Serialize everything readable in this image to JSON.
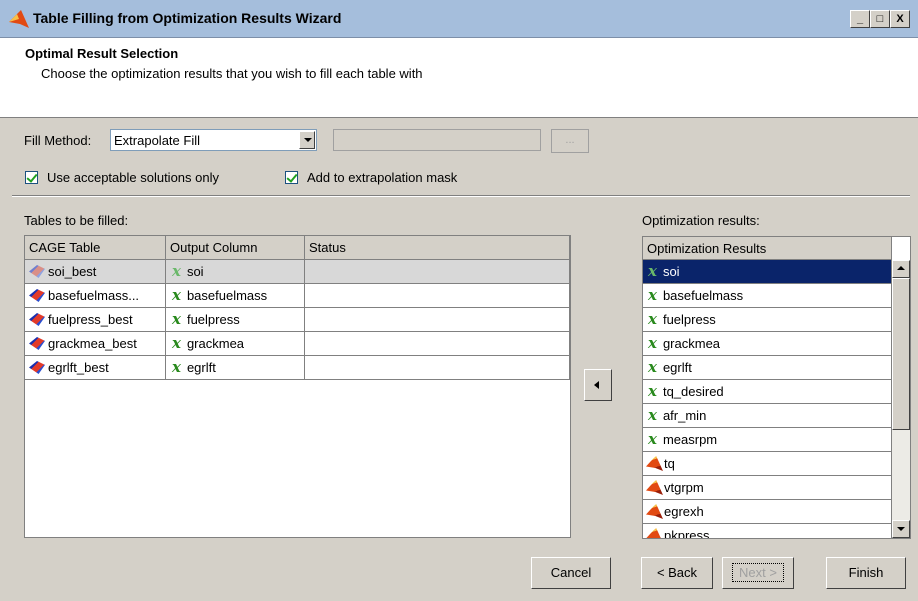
{
  "window": {
    "title": "Table Filling from Optimization Results Wizard",
    "minimize": "_",
    "maximize": "□",
    "close": "X"
  },
  "header": {
    "title": "Optimal Result Selection",
    "subtitle": "Choose the optimization results that you wish to fill each table with"
  },
  "fill_method": {
    "label": "Fill Method:",
    "value": "Extrapolate Fill",
    "browse_label": "..."
  },
  "checkboxes": {
    "acceptable": {
      "label": "Use acceptable solutions only",
      "checked": true
    },
    "mask": {
      "label": "Add to extrapolation mask",
      "checked": true
    }
  },
  "tables": {
    "label": "Tables to be filled:",
    "columns": [
      "CAGE Table",
      "Output Column",
      "Status"
    ],
    "rows": [
      {
        "table": "soi_best",
        "output": "soi",
        "status": ""
      },
      {
        "table": "basefuelmass...",
        "output": "basefuelmass",
        "status": ""
      },
      {
        "table": "fuelpress_best",
        "output": "fuelpress",
        "status": ""
      },
      {
        "table": "grackmea_best",
        "output": "grackmea",
        "status": ""
      },
      {
        "table": "egrlft_best",
        "output": "egrlft",
        "status": ""
      }
    ]
  },
  "results": {
    "label": "Optimization results:",
    "header": "Optimization Results",
    "items": [
      {
        "name": "soi",
        "icon": "variable-x-icon"
      },
      {
        "name": "basefuelmass",
        "icon": "variable-x-icon"
      },
      {
        "name": "fuelpress",
        "icon": "variable-x-icon"
      },
      {
        "name": "grackmea",
        "icon": "variable-x-icon"
      },
      {
        "name": "egrlft",
        "icon": "variable-x-icon"
      },
      {
        "name": "tq_desired",
        "icon": "variable-x-icon"
      },
      {
        "name": "afr_min",
        "icon": "variable-x-icon"
      },
      {
        "name": "measrpm",
        "icon": "variable-x-icon"
      },
      {
        "name": "tq",
        "icon": "matlab-icon"
      },
      {
        "name": "vtgrpm",
        "icon": "matlab-icon"
      },
      {
        "name": "egrexh",
        "icon": "matlab-icon"
      },
      {
        "name": "pkpress",
        "icon": "matlab-icon"
      }
    ]
  },
  "buttons": {
    "cancel": "Cancel",
    "back": "< Back",
    "next": "Next >",
    "finish": "Finish"
  },
  "colors": {
    "titlebar": "#a5bedc",
    "selection": "#0a246a",
    "dialog": "#d4d0c8"
  }
}
